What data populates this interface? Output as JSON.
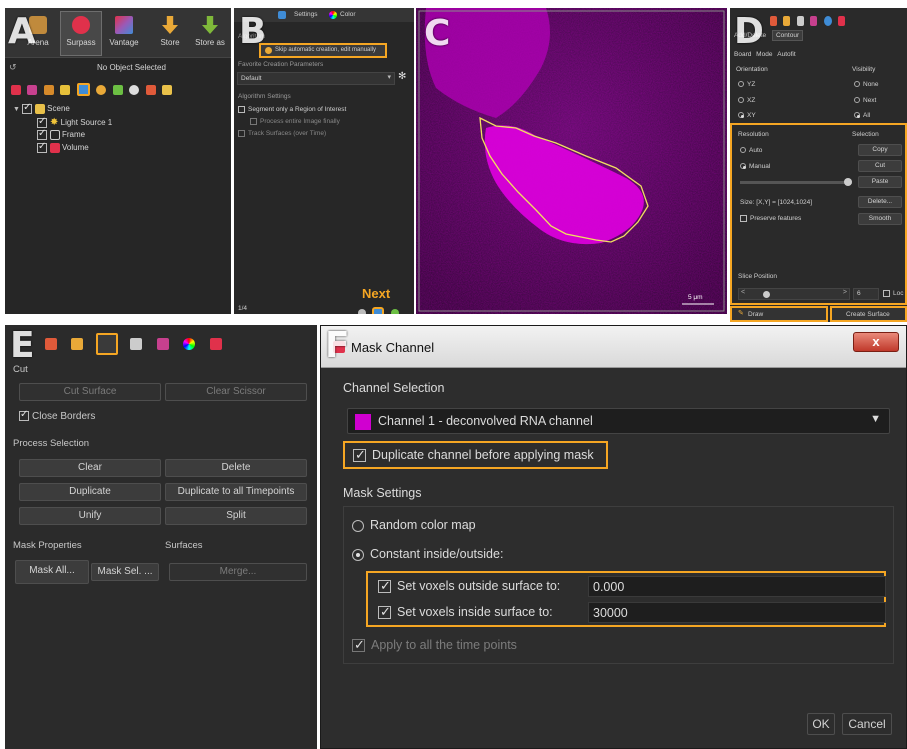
{
  "panel_letters": {
    "a": "A",
    "b": "B",
    "c": "C",
    "d": "D",
    "e": "E",
    "f": "F"
  },
  "panel_a": {
    "toolbar": [
      {
        "label": "Arena",
        "icon": "arena-icon"
      },
      {
        "label": "Surpass",
        "icon": "surpass-icon"
      },
      {
        "label": "Vantage",
        "icon": "vantage-icon"
      },
      {
        "label": "Store",
        "icon": "store-icon"
      },
      {
        "label": "Store as",
        "icon": "store-as-icon"
      }
    ],
    "status": "No Object Selected",
    "tree": [
      {
        "label": "Scene",
        "icon": "folder-icon",
        "level": 0
      },
      {
        "label": "Light Source 1",
        "icon": "light-icon",
        "level": 1
      },
      {
        "label": "Frame",
        "icon": "frame-icon",
        "level": 1
      },
      {
        "label": "Volume",
        "icon": "volume-icon",
        "level": 1
      }
    ]
  },
  "panel_b": {
    "tabs": [
      "Settings",
      "Color"
    ],
    "section_label": "Algorithm",
    "skip_button": "Skip automatic creation, edit manually",
    "fav_label": "Favorite Creation Parameters",
    "fav_value": "Default",
    "algo_label": "Algorithm Settings",
    "options": [
      {
        "label": "Segment only a Region of Interest",
        "checked": false
      },
      {
        "label": "Process entire Image finally",
        "checked": false
      },
      {
        "label": "Track Surfaces (over Time)",
        "checked": false
      }
    ],
    "page": "1/4",
    "next_label": "Next"
  },
  "panel_c": {
    "scale_label": "5 μm"
  },
  "panel_d": {
    "subtabs": [
      "Add/Delete",
      "Contour"
    ],
    "modes": [
      "Board",
      "Mode",
      "Autofit"
    ],
    "orientation_label": "Orientation",
    "visibility_label": "Visibility",
    "orientation": [
      "YZ",
      "XZ",
      "XY"
    ],
    "visibility": [
      "None",
      "Next",
      "All"
    ],
    "resolution_label": "Resolution",
    "selection_label": "Selection",
    "resolution": [
      "Auto",
      "Manual"
    ],
    "selection_buttons": [
      "Copy",
      "Cut",
      "Paste",
      "Delete...",
      "Smooth"
    ],
    "size_text": "Size: [X,Y] = [1024,1024]",
    "preserve": "Preserve features",
    "slice_label": "Slice Position",
    "slice_value": "6",
    "lock": "Loc",
    "draw": "Draw",
    "create": "Create Surface"
  },
  "panel_e": {
    "cut_label": "Cut",
    "cut_surface": "Cut Surface",
    "clear_scissor": "Clear Scissor",
    "close_borders": "Close Borders",
    "process_label": "Process Selection",
    "buttons": [
      "Clear",
      "Delete",
      "Duplicate",
      "Duplicate to all Timepoints",
      "Unify",
      "Split"
    ],
    "mask_label": "Mask Properties",
    "surfaces_label": "Surfaces",
    "mask_all": "Mask All...",
    "mask_sel": "Mask Sel. ...",
    "merge": "Merge..."
  },
  "panel_f": {
    "title": "Mask Channel",
    "close": "x",
    "channel_section": "Channel Selection",
    "channel": "Channel 1 - deconvolved RNA channel",
    "channel_color": "#d000d0",
    "duplicate": "Duplicate channel before applying mask",
    "mask_section": "Mask Settings",
    "random": "Random color map",
    "constant": "Constant inside/outside:",
    "outside_label": "Set voxels outside surface to:",
    "outside_value": "0.000",
    "inside_label": "Set voxels inside surface to:",
    "inside_value": "30000",
    "apply_all": "Apply to all the time points",
    "ok": "OK",
    "cancel": "Cancel"
  },
  "colors": {
    "highlight": "#f5a623",
    "magenta": "#d000d0",
    "panel": "#2b2b2b"
  }
}
